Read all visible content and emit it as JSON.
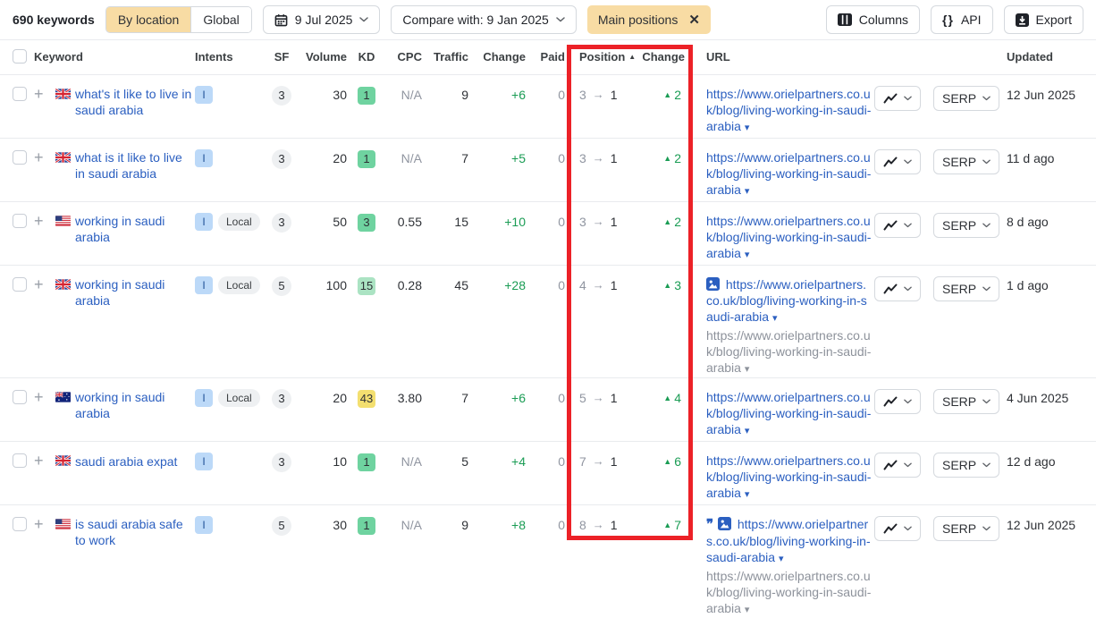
{
  "toolbar": {
    "keywords_count": "690 keywords",
    "by_location_label": "By location",
    "global_label": "Global",
    "date_label": "9 Jul 2025",
    "compare_label": "Compare with: 9 Jan 2025",
    "filter_chip_label": "Main positions",
    "columns_label": "Columns",
    "api_label": "API",
    "export_label": "Export"
  },
  "icons": {
    "close": "✕",
    "api_braces": "{}",
    "url_caret": "▾",
    "arrow_right": "→",
    "up_triangle": "▲",
    "sort_asc": "▲",
    "plus": "+",
    "quote": "❞"
  },
  "colors": {
    "accent_tan": "#F8DCA4",
    "link_blue": "#2B5FC0",
    "positive_green": "#1A9C54",
    "kd_green": "#6FD3A0",
    "kd_light_green": "#ABE3C3",
    "kd_yellow": "#F3DF70",
    "highlight_red": "#EC2127"
  },
  "table": {
    "na_label": "N/A",
    "serp_label": "SERP",
    "columns": {
      "keyword": "Keyword",
      "intents": "Intents",
      "sf": "SF",
      "volume": "Volume",
      "kd": "KD",
      "cpc": "CPC",
      "traffic": "Traffic",
      "change": "Change",
      "paid": "Paid",
      "position": "Position",
      "position_change": "Change",
      "url": "URL",
      "updated": "Updated"
    },
    "rows": [
      {
        "flag": "gb",
        "keyword": "what's it like to live in saudi arabia",
        "intents": [
          "I"
        ],
        "sf": "3",
        "volume": "30",
        "kd": "1",
        "kd_color": "green",
        "cpc": "N/A",
        "traffic": "9",
        "traffic_change": "+6",
        "paid": "0",
        "position_from": "3",
        "position_to": "1",
        "position_change": "2",
        "url": "https://www.orielpartners.co.uk/blog/living-working-in-saudi-arabia",
        "url_icons": [],
        "secondary_url": null,
        "updated": "12 Jun 2025"
      },
      {
        "flag": "gb",
        "keyword": "what is it like to live in saudi arabia",
        "intents": [
          "I"
        ],
        "sf": "3",
        "volume": "20",
        "kd": "1",
        "kd_color": "green",
        "cpc": "N/A",
        "traffic": "7",
        "traffic_change": "+5",
        "paid": "0",
        "position_from": "3",
        "position_to": "1",
        "position_change": "2",
        "url": "https://www.orielpartners.co.uk/blog/living-working-in-saudi-arabia",
        "url_icons": [],
        "secondary_url": null,
        "updated": "11 d ago"
      },
      {
        "flag": "us",
        "keyword": "working in saudi arabia",
        "intents": [
          "I",
          "Local"
        ],
        "sf": "3",
        "volume": "50",
        "kd": "3",
        "kd_color": "green",
        "cpc": "0.55",
        "traffic": "15",
        "traffic_change": "+10",
        "paid": "0",
        "position_from": "3",
        "position_to": "1",
        "position_change": "2",
        "url": "https://www.orielpartners.co.uk/blog/living-working-in-saudi-arabia",
        "url_icons": [],
        "secondary_url": null,
        "updated": "8 d ago"
      },
      {
        "flag": "gb",
        "keyword": "working in saudi arabia",
        "intents": [
          "I",
          "Local"
        ],
        "sf": "5",
        "volume": "100",
        "kd": "15",
        "kd_color": "green-light",
        "cpc": "0.28",
        "traffic": "45",
        "traffic_change": "+28",
        "paid": "0",
        "position_from": "4",
        "position_to": "1",
        "position_change": "3",
        "url": "https://www.orielpartners.co.uk/blog/living-working-in-saudi-arabia",
        "url_icons": [
          "image"
        ],
        "secondary_url": "https://www.orielpartners.co.uk/blog/living-working-in-saudi-arabia",
        "updated": "1 d ago"
      },
      {
        "flag": "au",
        "keyword": "working in saudi arabia",
        "intents": [
          "I",
          "Local"
        ],
        "sf": "3",
        "volume": "20",
        "kd": "43",
        "kd_color": "yellow",
        "cpc": "3.80",
        "traffic": "7",
        "traffic_change": "+6",
        "paid": "0",
        "position_from": "5",
        "position_to": "1",
        "position_change": "4",
        "url": "https://www.orielpartners.co.uk/blog/living-working-in-saudi-arabia",
        "url_icons": [],
        "secondary_url": null,
        "updated": "4 Jun 2025"
      },
      {
        "flag": "gb",
        "keyword": "saudi arabia expat",
        "intents": [
          "I"
        ],
        "sf": "3",
        "volume": "10",
        "kd": "1",
        "kd_color": "green",
        "cpc": "N/A",
        "traffic": "5",
        "traffic_change": "+4",
        "paid": "0",
        "position_from": "7",
        "position_to": "1",
        "position_change": "6",
        "url": "https://www.orielpartners.co.uk/blog/living-working-in-saudi-arabia",
        "url_icons": [],
        "secondary_url": null,
        "updated": "12 d ago"
      },
      {
        "flag": "us",
        "keyword": "is saudi arabia safe to work",
        "intents": [
          "I"
        ],
        "sf": "5",
        "volume": "30",
        "kd": "1",
        "kd_color": "green",
        "cpc": "N/A",
        "traffic": "9",
        "traffic_change": "+8",
        "paid": "0",
        "position_from": "8",
        "position_to": "1",
        "position_change": "7",
        "url": "https://www.orielpartners.co.uk/blog/living-working-in-saudi-arabia",
        "url_icons": [
          "quote",
          "image"
        ],
        "secondary_url": "https://www.orielpartners.co.uk/blog/living-working-in-saudi-arabia",
        "updated": "12 Jun 2025"
      }
    ]
  }
}
